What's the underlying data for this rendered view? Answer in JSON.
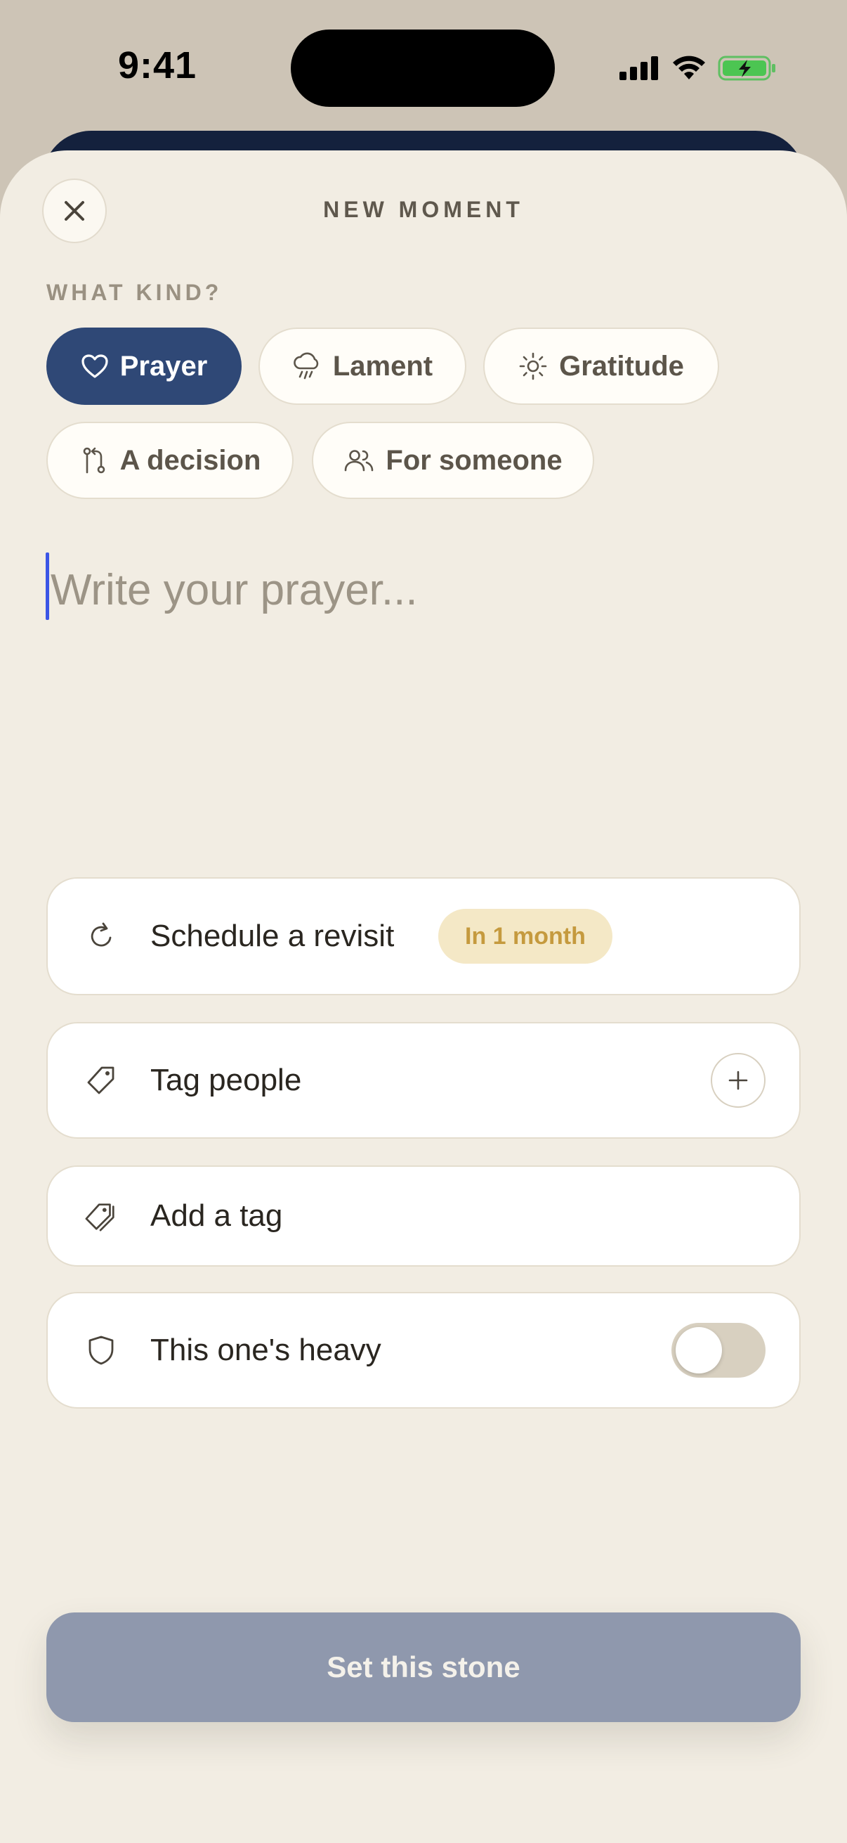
{
  "status_bar": {
    "time": "9:41",
    "icons": [
      "cellular-signal-icon",
      "wifi-icon",
      "battery-charging-icon"
    ]
  },
  "sheet": {
    "title": "NEW MOMENT",
    "close_icon": "close-icon"
  },
  "kind_section": {
    "label": "WHAT KIND?",
    "options": [
      {
        "label": "Prayer",
        "icon": "heart-icon",
        "selected": true
      },
      {
        "label": "Lament",
        "icon": "rain-cloud-icon",
        "selected": false
      },
      {
        "label": "Gratitude",
        "icon": "sun-icon",
        "selected": false
      },
      {
        "label": "A decision",
        "icon": "branch-icon",
        "selected": false
      },
      {
        "label": "For someone",
        "icon": "people-icon",
        "selected": false
      }
    ]
  },
  "entry": {
    "placeholder": "Write your prayer...",
    "value": ""
  },
  "options": {
    "revisit": {
      "label": "Schedule a revisit",
      "badge": "In 1 month",
      "icon": "refresh-icon"
    },
    "tag_people": {
      "label": "Tag people",
      "icon": "tag-icon",
      "action_icon": "plus-icon"
    },
    "add_tag": {
      "label": "Add a tag",
      "icon": "tags-icon"
    },
    "heavy": {
      "label": "This one's heavy",
      "icon": "shield-icon",
      "enabled": false
    }
  },
  "cta": {
    "label": "Set this stone"
  },
  "colors": {
    "sheet_bg": "#f2ede3",
    "accent_navy": "#2f4876",
    "cta_disabled": "#8f98ad",
    "badge_bg": "#f4e8c6",
    "badge_text": "#c59a3e",
    "caret": "#3b55e6"
  }
}
